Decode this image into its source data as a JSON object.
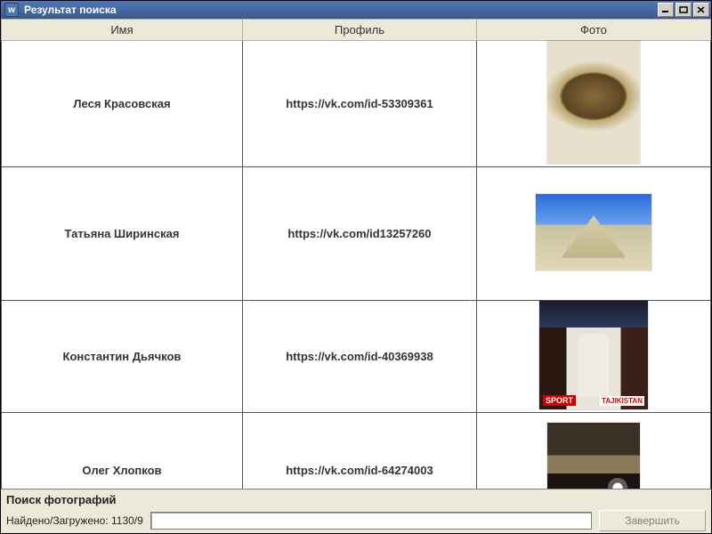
{
  "window": {
    "title": "Результат поиска",
    "app_icon_letter": "w"
  },
  "columns": {
    "name": "Имя",
    "profile": "Профиль",
    "photo": "Фото"
  },
  "rows": [
    {
      "name": "Леся Красовская",
      "profile": "https://vk.com/id-53309361"
    },
    {
      "name": "Татьяна Ширинская",
      "profile": "https://vk.com/id13257260"
    },
    {
      "name": "Константин Дьячков",
      "profile": "https://vk.com/id-40369938"
    },
    {
      "name": "Олег Хлопков",
      "profile": "https://vk.com/id-64274003"
    }
  ],
  "photo_tags": {
    "row3_left": "SPORT",
    "row3_right": "TAJIKISTAN"
  },
  "status": {
    "section_title": "Поиск фотографий",
    "found_label": "Найдено/Загружено: 1130/9",
    "finish_label": "Завершить"
  }
}
